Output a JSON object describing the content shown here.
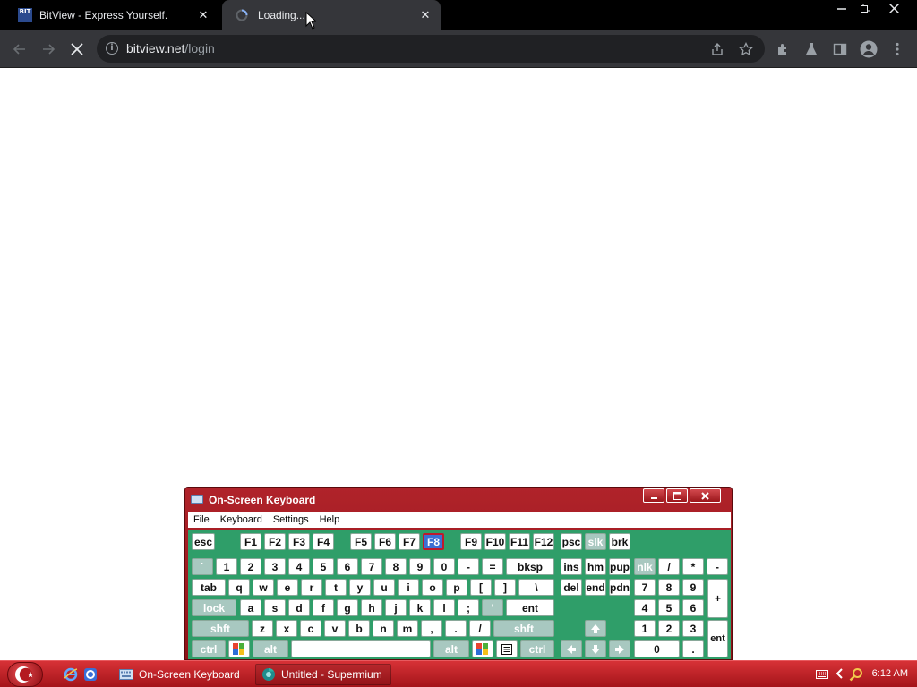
{
  "browser": {
    "tabs": [
      {
        "title": "BitView - Express Yourself.",
        "favicon": "bitview-logo-icon",
        "favicon_text": "BIT"
      },
      {
        "title": "Loading...",
        "favicon": "loading-spinner-icon",
        "active": true
      }
    ],
    "url_domain": "bitview.net",
    "url_path": "/login"
  },
  "osk": {
    "title": "On-Screen Keyboard",
    "menu": [
      "File",
      "Keyboard",
      "Settings",
      "Help"
    ],
    "rows": [
      [
        "esc",
        "F1",
        "F2",
        "F3",
        "F4",
        "F5",
        "F6",
        "F7",
        "F8",
        "F9",
        "F10",
        "F11",
        "F12",
        "psc",
        "slk",
        "brk"
      ],
      [
        "`",
        "1",
        "2",
        "3",
        "4",
        "5",
        "6",
        "7",
        "8",
        "9",
        "0",
        "-",
        "=",
        "bksp",
        "ins",
        "hm",
        "pup",
        "nlk",
        "/",
        "*",
        "-"
      ],
      [
        "tab",
        "q",
        "w",
        "e",
        "r",
        "t",
        "y",
        "u",
        "i",
        "o",
        "p",
        "[",
        "]",
        "\\",
        "del",
        "end",
        "pdn",
        "7",
        "8",
        "9",
        "+"
      ],
      [
        "lock",
        "a",
        "s",
        "d",
        "f",
        "g",
        "h",
        "j",
        "k",
        "l",
        ";",
        "'",
        "ent",
        "4",
        "5",
        "6"
      ],
      [
        "shft",
        "z",
        "x",
        "c",
        "v",
        "b",
        "n",
        "m",
        ",",
        ".",
        "/",
        "shft",
        "1",
        "2",
        "3",
        "ent"
      ],
      [
        "ctrl",
        "alt",
        "alt",
        "ctrl",
        "0",
        "."
      ]
    ],
    "active_key": "F8",
    "disabled_keys": [
      "slk",
      "nlk",
      "`",
      "lock",
      "'",
      "shft",
      "ctrl",
      "alt"
    ]
  },
  "taskbar": {
    "items": [
      {
        "label": "On-Screen Keyboard",
        "icon": "keyboard-icon"
      },
      {
        "label": "Untitled - Supermium",
        "icon": "supermium-icon"
      }
    ],
    "clock": "6:12 AM"
  },
  "colors": {
    "osk_title_red": "#b0232a",
    "osk_key_area_green": "#2f9e69",
    "taskbar_red": "#c4252b",
    "active_key_blue": "#3c6fd3"
  }
}
